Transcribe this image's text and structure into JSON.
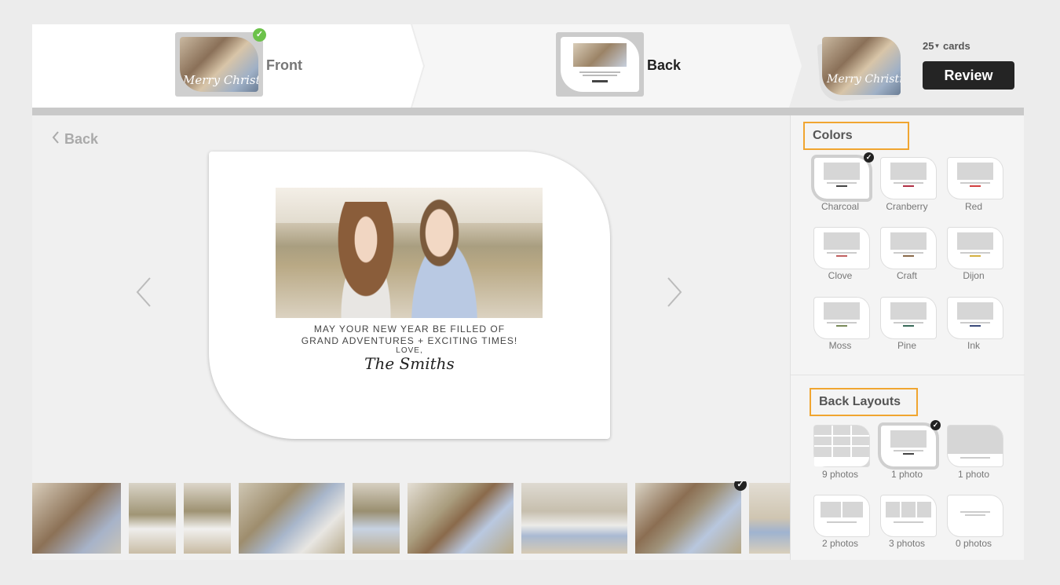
{
  "steps": {
    "front_label": "Front",
    "back_label": "Back",
    "front_script": "Merry Christmas"
  },
  "review": {
    "quantity": "25",
    "quantity_unit": "cards",
    "review_label": "Review"
  },
  "editor": {
    "back_link": "Back",
    "message_line1": "MAY YOUR NEW YEAR BE FILLED OF",
    "message_line2": "GRAND ADVENTURES + EXCITING TIMES!",
    "message_line3": "LOVE,",
    "signature": "The Smiths"
  },
  "colors_section": {
    "title": "Colors",
    "selected": "Charcoal",
    "options": [
      {
        "label": "Charcoal",
        "accent": "#444444"
      },
      {
        "label": "Cranberry",
        "accent": "#b03045"
      },
      {
        "label": "Red",
        "accent": "#d24040"
      },
      {
        "label": "Clove",
        "accent": "#c06060"
      },
      {
        "label": "Craft",
        "accent": "#8a6a4a"
      },
      {
        "label": "Dijon",
        "accent": "#d4b040"
      },
      {
        "label": "Moss",
        "accent": "#7a8a5a"
      },
      {
        "label": "Pine",
        "accent": "#3a6a5a"
      },
      {
        "label": "Ink",
        "accent": "#3a4a7a"
      }
    ]
  },
  "layouts_section": {
    "title": "Back Layouts",
    "selected": "1 photo",
    "options": [
      {
        "label": "9 photos"
      },
      {
        "label": "1 photo"
      },
      {
        "label": "1 photo"
      },
      {
        "label": "2 photos"
      },
      {
        "label": "3 photos"
      },
      {
        "label": "0 photos"
      }
    ]
  },
  "filmstrip": {
    "count": 9
  },
  "colors": {
    "accent_orange": "#f0a530",
    "check_green": "#6cc24a",
    "review_bg": "#242424"
  }
}
